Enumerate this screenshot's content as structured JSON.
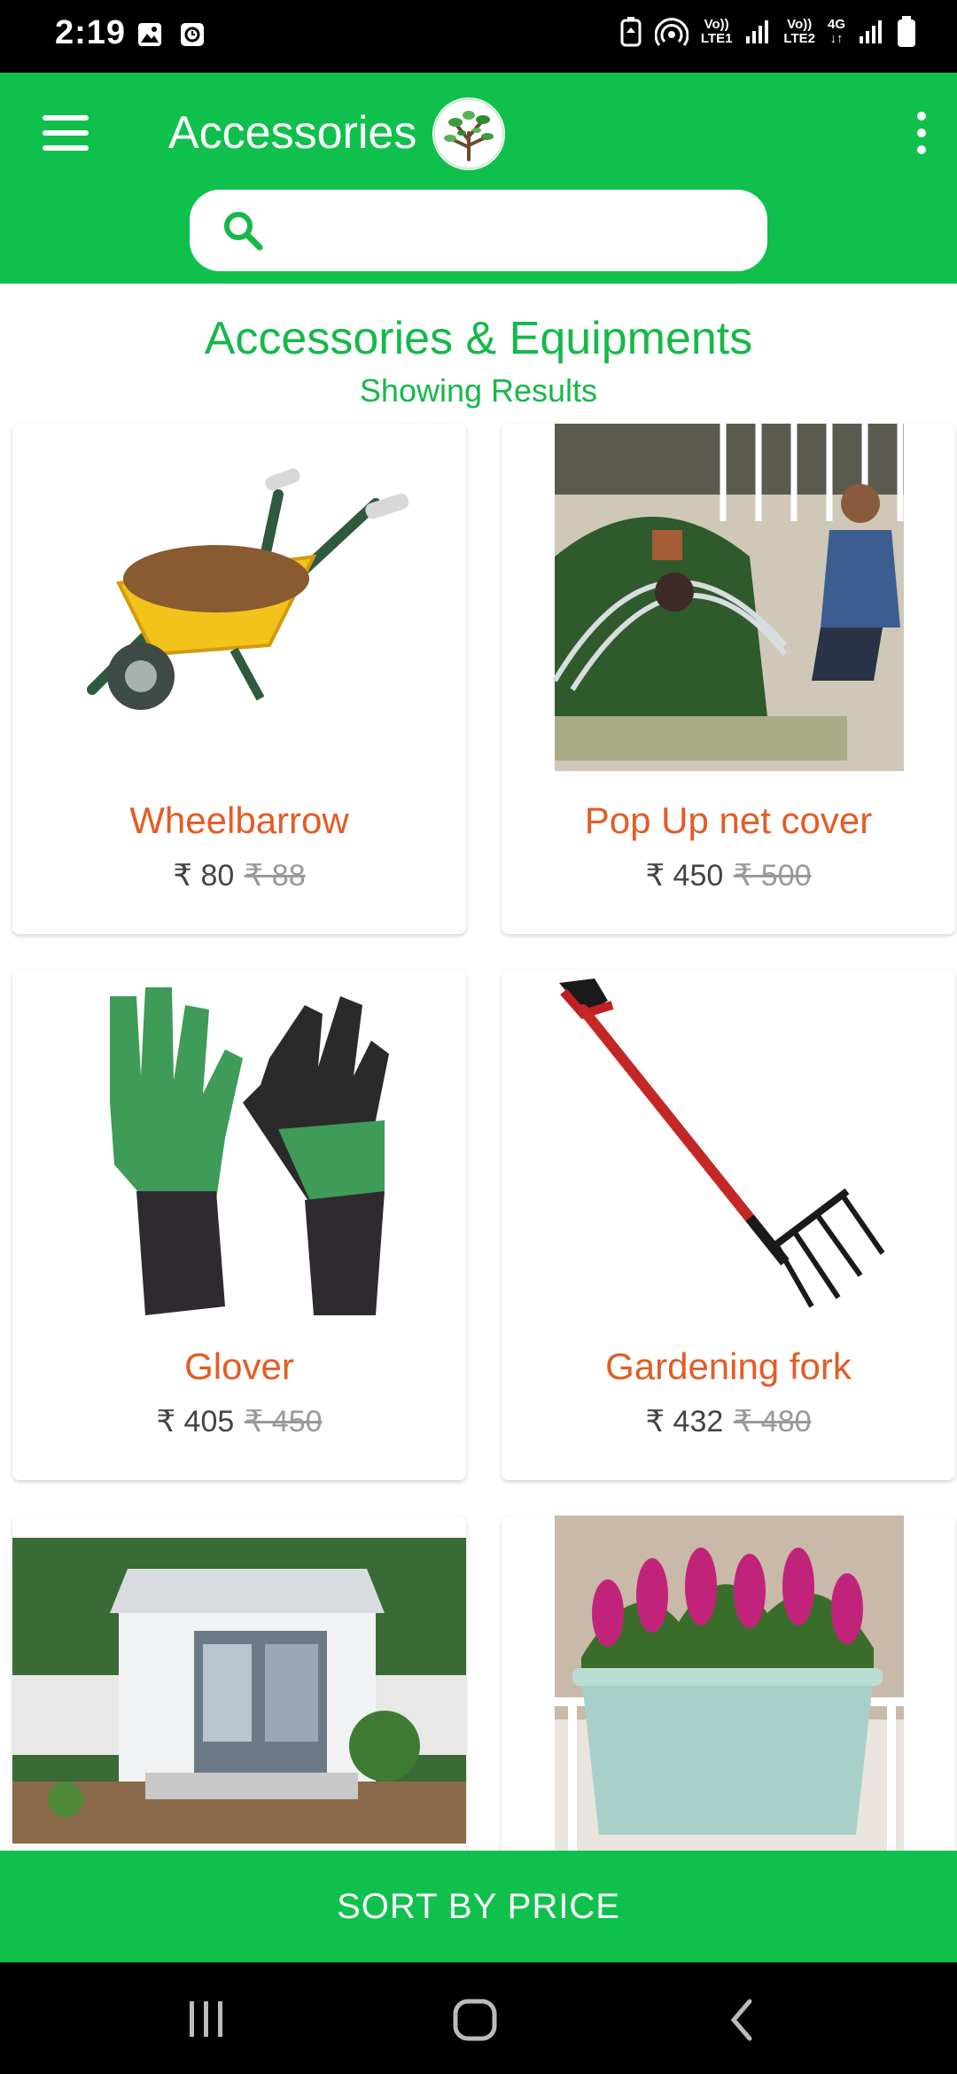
{
  "status_bar": {
    "time": "2:19",
    "sim1": {
      "label_top": "Vo))",
      "label_bottom": "LTE1"
    },
    "sim2": {
      "label_top": "Vo))",
      "label_bottom": "LTE2"
    },
    "network": "4G"
  },
  "app_bar": {
    "title": "Accessories",
    "logo_icon": "tree-logo-icon",
    "menu_icon": "hamburger-menu-icon",
    "overflow_icon": "more-vert-icon",
    "search_placeholder": "",
    "search_value": ""
  },
  "section": {
    "title": "Accessories & Equipments",
    "subtitle": "Showing Results"
  },
  "products": [
    {
      "name": "Wheelbarrow",
      "price": "₹ 80",
      "old_price": "₹ 88",
      "image": "wheelbarrow"
    },
    {
      "name": "Pop Up net cover",
      "price": "₹ 450",
      "old_price": "₹ 500",
      "image": "net-cover-garden-bed"
    },
    {
      "name": "Glover",
      "price": "₹ 405",
      "old_price": "₹ 450",
      "image": "gardening-gloves"
    },
    {
      "name": "Gardening fork",
      "price": "₹ 432",
      "old_price": "₹ 480",
      "image": "garden-fork"
    },
    {
      "name": "",
      "price": "",
      "old_price": "",
      "image": "garden-shed"
    },
    {
      "name": "",
      "price": "",
      "old_price": "",
      "image": "railing-planter-flowers"
    }
  ],
  "sort_bar": {
    "label": "SORT BY PRICE"
  },
  "colors": {
    "brand_green": "#0fc14c",
    "title_green": "#16b84a",
    "product_name": "#e35c24"
  }
}
